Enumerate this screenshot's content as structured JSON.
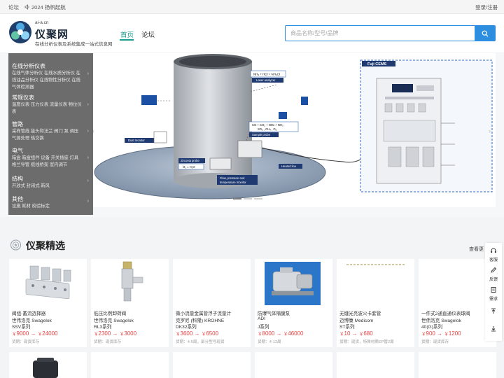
{
  "topbar": {
    "forum": "论坛",
    "announcement": "2024 扬帆起航",
    "login": "登录/注册"
  },
  "header": {
    "domain": "ai-a.cn",
    "brand": "仪聚网",
    "slogan": "在线分析仪表及系统集成一站式信息网",
    "nav_home": "首页",
    "nav_forum": "论坛",
    "search_placeholder": "商品名称/型号/品牌"
  },
  "categories": [
    {
      "title": "在线分析仪表",
      "sub": "在线气体分析仪 在线水质分析仪 在线油品分析仪 在线物性分析仪 在线气体检测器"
    },
    {
      "title": "常规仪表",
      "sub": "温度仪表 压力仪表 流量仪表 物位仪表"
    },
    {
      "title": "管路",
      "sub": "采样管线 接头和法兰 阀门 泵 调压 气源处理 热交换"
    },
    {
      "title": "电气",
      "sub": "箱盒 箱盒组件 设备 开关插座 灯具 格兰导管 缆线桥架 室内调节"
    },
    {
      "title": "结构",
      "sub": "开放式 封闭式 新风"
    },
    {
      "title": "其他",
      "sub": "设施 耗材 校验标定"
    }
  ],
  "hero": {
    "labels": {
      "reaction1": "NH₃ + HCl = NH₄Cl",
      "laser": "Laser analyzer",
      "reaction2": "CO + CO₂ + NOx + NH₃",
      "reaction3": "SO₂ , CH₄ , O₂",
      "sample_probe": "Sample probe",
      "dust": "Dust monitor",
      "zirconia": "Zirconia probe",
      "o2": "O₂ = H₂O",
      "flow": "Flow, pressure and",
      "flow2": "temperature monitor",
      "heated": "Heated line",
      "cems": "Fuji CEMS"
    }
  },
  "section": {
    "title": "仪聚精选",
    "see_more": "查看更"
  },
  "products": [
    {
      "name": "阀组-蓄流选择器",
      "brand": "世伟洛克 Swagelok",
      "series": "SSV系列",
      "price_low": "9000",
      "price_high": "24000",
      "delivery": "货期：现货库存"
    },
    {
      "name": "低压比例卸荷阀",
      "brand": "世伟洛克 Swagelok",
      "series": "RL3系列",
      "price_low": "2300",
      "price_high": "3000",
      "delivery": "货期：现货库存"
    },
    {
      "name": "微小流量金属管浮子流量计",
      "brand": "克罗尼 (科隆)   KROHNE",
      "series": "DK32系列",
      "price_low": "3600",
      "price_high": "6500",
      "delivery": "货期：4-5周，部分型号现货"
    },
    {
      "name": "防爆气体隔膜泵",
      "brand": "ADI",
      "series": "J系列",
      "price_low": "8000",
      "price_high": "46000",
      "delivery": "货期：4-12周"
    },
    {
      "name": "无缝光亮波火卡套管",
      "brand": "迈博康 Medicom",
      "series": "ST系列",
      "price_low": "10",
      "price_high": "680",
      "delivery": "货期：现货，特殊材质EP管2周"
    },
    {
      "name": "一件式2通直通仪表球阀",
      "brand": "世伟洛克 Swagelok",
      "series": "40(G)系列",
      "price_low": "900",
      "price_high": "1200",
      "delivery": "货期：现货库存"
    }
  ],
  "currency": "￥",
  "price_sep": " → ",
  "floatbar": {
    "service": "客服",
    "feedback": "反馈",
    "demand": "需求"
  },
  "colors": {
    "accent": "#2d8ee0",
    "nav_active": "#1a9f8e",
    "price": "#e54242"
  }
}
